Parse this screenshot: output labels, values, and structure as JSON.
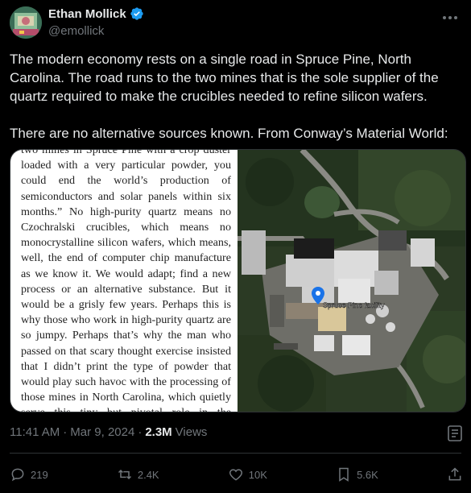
{
  "author": {
    "name": "Ethan Mollick",
    "handle": "@emollick"
  },
  "tweet": {
    "text": "The modern economy rests on a single road in Spruce Pine, North Carolina. The road runs to the two mines that is the sole supplier of the quartz required to make the crucibles needed to refine silicon wafers.\n\nThere are no alternative sources known. From Conway’s Material World:"
  },
  "media": {
    "book_excerpt": "two mines in Spruce Pine with a crop duster loaded with a very particular powder, you could end the world’s production of semiconductors and solar panels within six months.” No high-purity quartz means no Czochralski crucibles, which means no monocrystalline silicon wafers, which means, well, the end of computer chip manufacture as we know it. We would adapt; find a new process or an alternative substance. But it would be a grisly few years. Perhaps this is why those who work in high-purity quartz are so jumpy. Perhaps that’s why the man who passed on that scary thought exercise insisted that I didn’t print the type of powder that would play such havoc with the processing of those mines in North Carolina, which quietly serve this tiny but pivotal role in the functioning of the modern world.",
    "map_label": "Spruce Pine facility"
  },
  "meta": {
    "time": "11:41 AM",
    "separator1": "·",
    "date": "Mar 9, 2024",
    "separator2": "·",
    "views_count": "2.3M",
    "views_label": "Views"
  },
  "actions": {
    "replies": "219",
    "reposts": "2.4K",
    "likes": "10K",
    "bookmarks": "5.6K"
  },
  "icons": {
    "verified": "verified-badge-icon",
    "more": "more-icon",
    "analytics": "analytics-icon",
    "reply": "reply-icon",
    "repost": "repost-icon",
    "like": "heart-icon",
    "bookmark": "bookmark-icon",
    "share": "share-icon"
  },
  "colors": {
    "background": "#000000",
    "text": "#e7e9ea",
    "muted": "#71767b",
    "verified": "#1d9bf0",
    "border": "#2f3336"
  }
}
